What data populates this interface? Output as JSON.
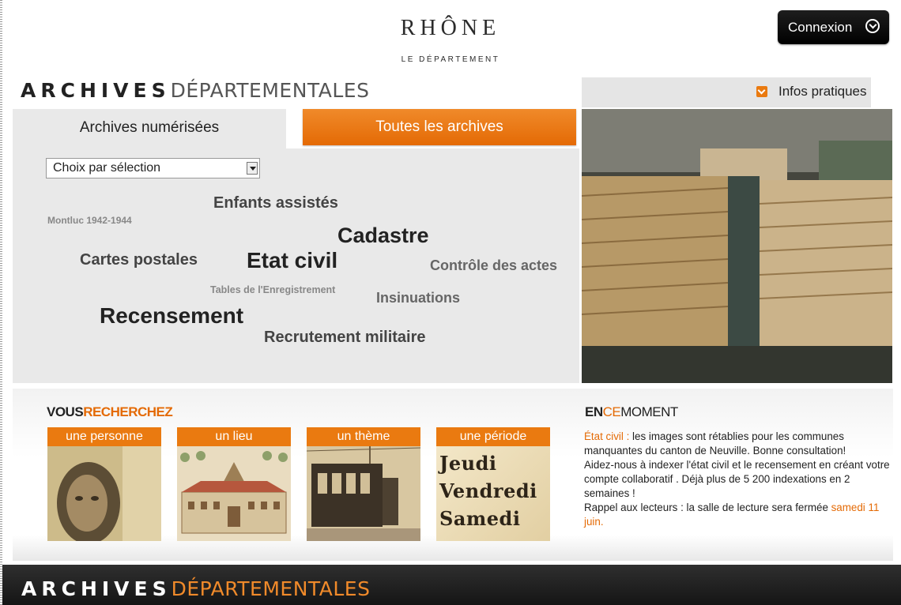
{
  "header": {
    "logo_name": "RHÔNE",
    "logo_sub": "LE DÉPARTEMENT",
    "login_label": "Connexion"
  },
  "title": {
    "strong": "ARCHIVES",
    "light": "DÉPARTEMENTALES"
  },
  "infos": {
    "label": "Infos pratiques"
  },
  "tabs": {
    "active": "Archives numérisées",
    "other": "Toutes les archives"
  },
  "select": {
    "value": "Choix par sélection"
  },
  "tags": [
    {
      "label": "Enfants assistés",
      "color": "#444444"
    },
    {
      "label": "Montluc 1942-1944",
      "color": "#888888"
    },
    {
      "label": "Cadastre",
      "color": "#222222"
    },
    {
      "label": "Cartes postales",
      "color": "#444444"
    },
    {
      "label": "Etat civil",
      "color": "#222222"
    },
    {
      "label": "Contrôle des actes",
      "color": "#666666"
    },
    {
      "label": "Tables de l'Enregistrement",
      "color": "#888888"
    },
    {
      "label": "Insinuations",
      "color": "#666666"
    },
    {
      "label": "Recensement",
      "color": "#222222"
    },
    {
      "label": "Recrutement militaire",
      "color": "#444444"
    }
  ],
  "vous": {
    "part1": "VOUS",
    "part2": "RECHERCHEZ"
  },
  "categories": [
    {
      "label": "une personne",
      "icon": "portrait-photo"
    },
    {
      "label": "un lieu",
      "icon": "abbey-drawing"
    },
    {
      "label": "un thème",
      "icon": "tram-photo"
    },
    {
      "label": "une période",
      "icon": "days-text"
    }
  ],
  "periode_words": [
    "Jeudi",
    "Vendredi",
    "Samedi"
  ],
  "encemoment": {
    "part1": "EN",
    "part2": "CE",
    "part3": "MOMENT"
  },
  "news": {
    "link1": "État civil :",
    "text1": " les images sont rétablies pour les communes manquantes du canton de Neuville. Bonne consultation!",
    "text2": "Aidez-nous à indexer l'état civil et le recensement en créant votre compte  collaboratif . Déjà plus de 5 200 indexations en 2 semaines !",
    "text3": "Rappel aux lecteurs : la salle de lecture sera fermée ",
    "link2": "samedi 11 juin",
    "text4": "."
  },
  "footer": {
    "strong": "ARCHIVES",
    "light": "DÉPARTEMENTALES"
  },
  "colors": {
    "accent": "#ea7a10",
    "dark": "#1a1a1a",
    "panel": "#e9e9e9"
  }
}
